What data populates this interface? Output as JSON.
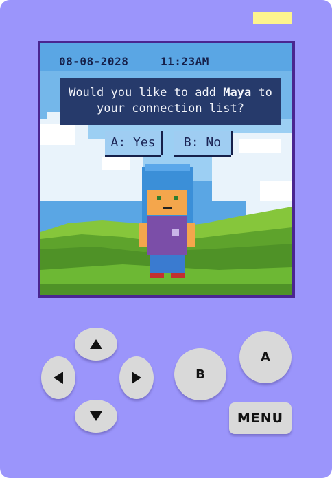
{
  "status_bar": {
    "date": "08-08-2028",
    "time": "11:23AM"
  },
  "dialog": {
    "line1_prefix": "Would you like to add ",
    "name": "Maya",
    "line1_suffix": " to",
    "line2": "your connection list?"
  },
  "choices": {
    "yes_label": "A: Yes",
    "no_label": "B: No"
  },
  "controls": {
    "a_label": "A",
    "b_label": "B",
    "menu_label": "MENU"
  },
  "icons": {
    "up": "triangle-up-icon",
    "down": "triangle-down-icon",
    "left": "triangle-left-icon",
    "right": "triangle-right-icon"
  },
  "colors": {
    "device": "#9b95fb",
    "screen_border": "#4a2590",
    "dialog_bg": "#263a6b",
    "choice_bg": "#9fcdf2",
    "button": "#d9d9d9",
    "led": "#fdf48e"
  }
}
